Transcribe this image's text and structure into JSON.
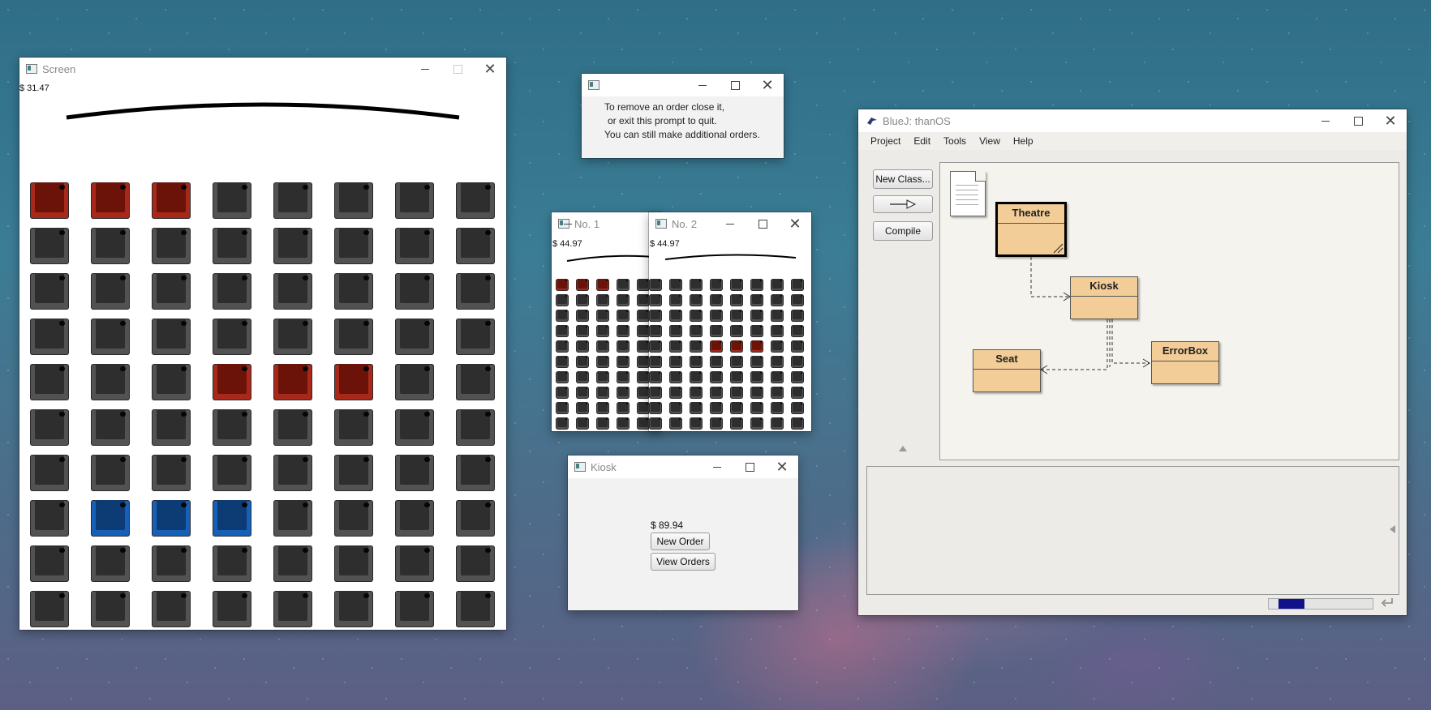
{
  "screen_window": {
    "title": "Screen",
    "price": "$ 31.47",
    "rows": [
      [
        "red",
        "red",
        "red",
        "gray",
        "gray",
        "gray",
        "gray",
        "gray"
      ],
      [
        "gray",
        "gray",
        "gray",
        "gray",
        "gray",
        "gray",
        "gray",
        "gray"
      ],
      [
        "gray",
        "gray",
        "gray",
        "gray",
        "gray",
        "gray",
        "gray",
        "gray"
      ],
      [
        "gray",
        "gray",
        "gray",
        "gray",
        "gray",
        "gray",
        "gray",
        "gray"
      ],
      [
        "gray",
        "gray",
        "gray",
        "red",
        "red",
        "red",
        "gray",
        "gray"
      ],
      [
        "gray",
        "gray",
        "gray",
        "gray",
        "gray",
        "gray",
        "gray",
        "gray"
      ],
      [
        "gray",
        "gray",
        "gray",
        "gray",
        "gray",
        "gray",
        "gray",
        "gray"
      ],
      [
        "gray",
        "blue",
        "blue",
        "blue",
        "gray",
        "gray",
        "gray",
        "gray"
      ],
      [
        "gray",
        "gray",
        "gray",
        "gray",
        "gray",
        "gray",
        "gray",
        "gray"
      ],
      [
        "gray",
        "gray",
        "gray",
        "gray",
        "gray",
        "gray",
        "gray",
        "gray"
      ]
    ]
  },
  "prompt_window": {
    "line1": "To remove an order close it,",
    "line2": "or exit this prompt to quit.",
    "line3": "You can still make additional orders."
  },
  "order1": {
    "title": "No. 1",
    "price": "$ 44.97",
    "rows": [
      [
        "red",
        "red",
        "red",
        "gray",
        "gray"
      ],
      [
        "gray",
        "gray",
        "gray",
        "gray",
        "gray"
      ],
      [
        "gray",
        "gray",
        "gray",
        "gray",
        "gray"
      ],
      [
        "gray",
        "gray",
        "gray",
        "gray",
        "gray"
      ],
      [
        "gray",
        "gray",
        "gray",
        "gray",
        "gray"
      ],
      [
        "gray",
        "gray",
        "gray",
        "gray",
        "gray"
      ],
      [
        "gray",
        "gray",
        "gray",
        "gray",
        "gray"
      ],
      [
        "gray",
        "gray",
        "gray",
        "gray",
        "gray"
      ],
      [
        "gray",
        "gray",
        "gray",
        "gray",
        "gray"
      ],
      [
        "gray",
        "gray",
        "gray",
        "gray",
        "gray"
      ]
    ]
  },
  "order2": {
    "title": "No. 2",
    "price": "$ 44.97",
    "rows": [
      [
        "gray",
        "gray",
        "gray",
        "gray",
        "gray",
        "gray",
        "gray",
        "gray"
      ],
      [
        "gray",
        "gray",
        "gray",
        "gray",
        "gray",
        "gray",
        "gray",
        "gray"
      ],
      [
        "gray",
        "gray",
        "gray",
        "gray",
        "gray",
        "gray",
        "gray",
        "gray"
      ],
      [
        "gray",
        "gray",
        "gray",
        "gray",
        "gray",
        "gray",
        "gray",
        "gray"
      ],
      [
        "gray",
        "gray",
        "gray",
        "red",
        "red",
        "red",
        "gray",
        "gray"
      ],
      [
        "gray",
        "gray",
        "gray",
        "gray",
        "gray",
        "gray",
        "gray",
        "gray"
      ],
      [
        "gray",
        "gray",
        "gray",
        "gray",
        "gray",
        "gray",
        "gray",
        "gray"
      ],
      [
        "gray",
        "gray",
        "gray",
        "gray",
        "gray",
        "gray",
        "gray",
        "gray"
      ],
      [
        "gray",
        "gray",
        "gray",
        "gray",
        "gray",
        "gray",
        "gray",
        "gray"
      ],
      [
        "gray",
        "gray",
        "gray",
        "gray",
        "gray",
        "gray",
        "gray",
        "gray"
      ]
    ]
  },
  "kiosk_window": {
    "title": "Kiosk",
    "price": "$ 89.94",
    "new_order_label": "New Order",
    "view_orders_label": "View Orders"
  },
  "bluej_window": {
    "title": "BlueJ:  thanOS",
    "menu": [
      "Project",
      "Edit",
      "Tools",
      "View",
      "Help"
    ],
    "new_class_label": "New Class...",
    "compile_label": "Compile",
    "classes": {
      "theatre": "Theatre",
      "kiosk": "Kiosk",
      "seat": "Seat",
      "errorbox": "ErrorBox"
    },
    "progress_fraction": 0.25
  },
  "colors": {
    "seat_gray": "#525252",
    "seat_red": "#a8291a",
    "seat_blue": "#1660b8",
    "class_fill": "#f3cd97"
  }
}
